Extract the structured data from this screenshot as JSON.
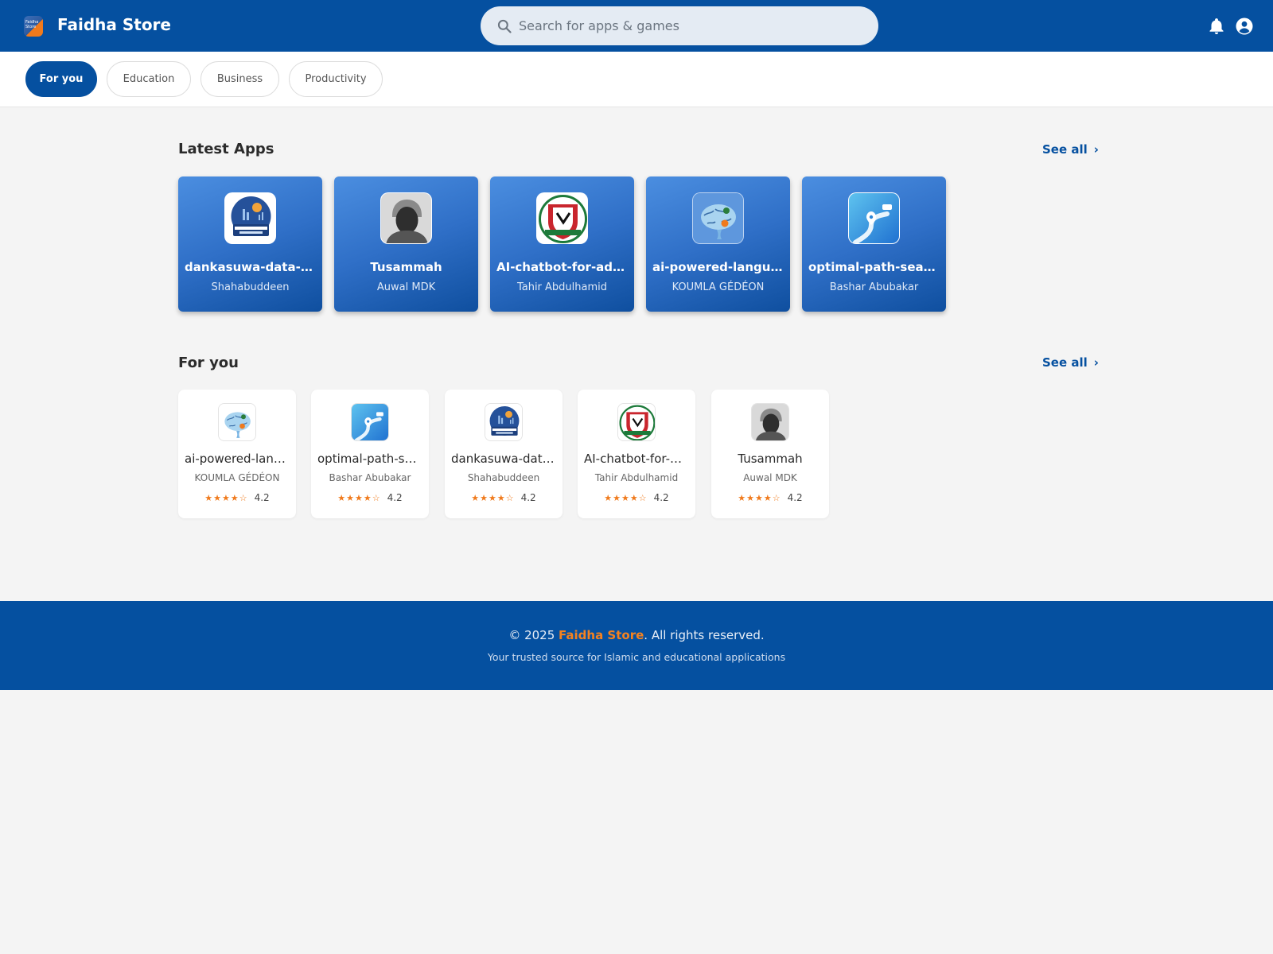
{
  "header": {
    "brand_name": "Faidha Store",
    "logo_text": "Faidha Store",
    "search_placeholder": "Search for apps & games"
  },
  "tabs": [
    {
      "label": "For you",
      "active": true
    },
    {
      "label": "Education",
      "active": false
    },
    {
      "label": "Business",
      "active": false
    },
    {
      "label": "Productivity",
      "active": false
    }
  ],
  "latest": {
    "title": "Latest Apps",
    "see_all": "See all",
    "apps": [
      {
        "name": "dankasuwa-data-sub",
        "developer": "Shahabuddeen",
        "icon": "dankasuwa-logo-icon"
      },
      {
        "name": "Tusammah",
        "developer": "Auwal MDK",
        "icon": "portrait-icon"
      },
      {
        "name": "AI-chatbot-for-admissions",
        "developer": "Tahir Abdulhamid",
        "icon": "crest-icon"
      },
      {
        "name": "ai-powered-language",
        "developer": "KOUMLA GÉDÉON",
        "icon": "brain-icon"
      },
      {
        "name": "optimal-path-search",
        "developer": "Bashar Abubakar",
        "icon": "route-icon"
      }
    ]
  },
  "for_you": {
    "title": "For you",
    "see_all": "See all",
    "apps": [
      {
        "name": "ai-powered-language",
        "developer": "KOUMLA GÉDÉON",
        "stars": "★★★★☆",
        "rating": "4.2",
        "icon": "brain-icon"
      },
      {
        "name": "optimal-path-search",
        "developer": "Bashar Abubakar",
        "stars": "★★★★☆",
        "rating": "4.2",
        "icon": "route-icon"
      },
      {
        "name": "dankasuwa-data-sub",
        "developer": "Shahabuddeen",
        "stars": "★★★★☆",
        "rating": "4.2",
        "icon": "dankasuwa-logo-icon"
      },
      {
        "name": "AI-chatbot-for-admissions",
        "developer": "Tahir Abdulhamid",
        "stars": "★★★★☆",
        "rating": "4.2",
        "icon": "crest-icon"
      },
      {
        "name": "Tusammah",
        "developer": "Auwal MDK",
        "stars": "★★★★☆",
        "rating": "4.2",
        "icon": "portrait-icon"
      }
    ]
  },
  "footer": {
    "copy_prefix": "© 2025 ",
    "copy_brand": "Faidha Store",
    "copy_suffix": ". All rights reserved.",
    "tagline": "Your trusted source for Islamic and educational applications"
  },
  "colors": {
    "primary": "#0550a0",
    "accent": "#f07a1c",
    "background": "#f4f4f4"
  }
}
